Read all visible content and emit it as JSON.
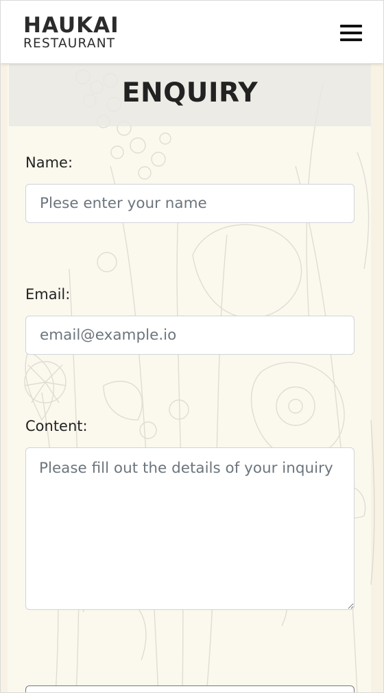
{
  "header": {
    "logo_main": "HAUKAI",
    "logo_sub": "RESTAURANT",
    "menu_icon": "hamburger-menu-icon"
  },
  "page": {
    "title": "ENQUIRY"
  },
  "form": {
    "name": {
      "label": "Name:",
      "placeholder": "Plese enter your name",
      "value": ""
    },
    "email": {
      "label": "Email:",
      "placeholder": "email@example.io",
      "value": ""
    },
    "content": {
      "label": "Content:",
      "placeholder": "Please fill out the details of your inquiry",
      "value": ""
    }
  },
  "colors": {
    "header_bg": "#ffffff",
    "page_bg": "#f7f2e4",
    "title_band": "#e9e9e3",
    "text": "#222222",
    "placeholder": "#6c757d",
    "field_border": "#cfd3d8"
  }
}
